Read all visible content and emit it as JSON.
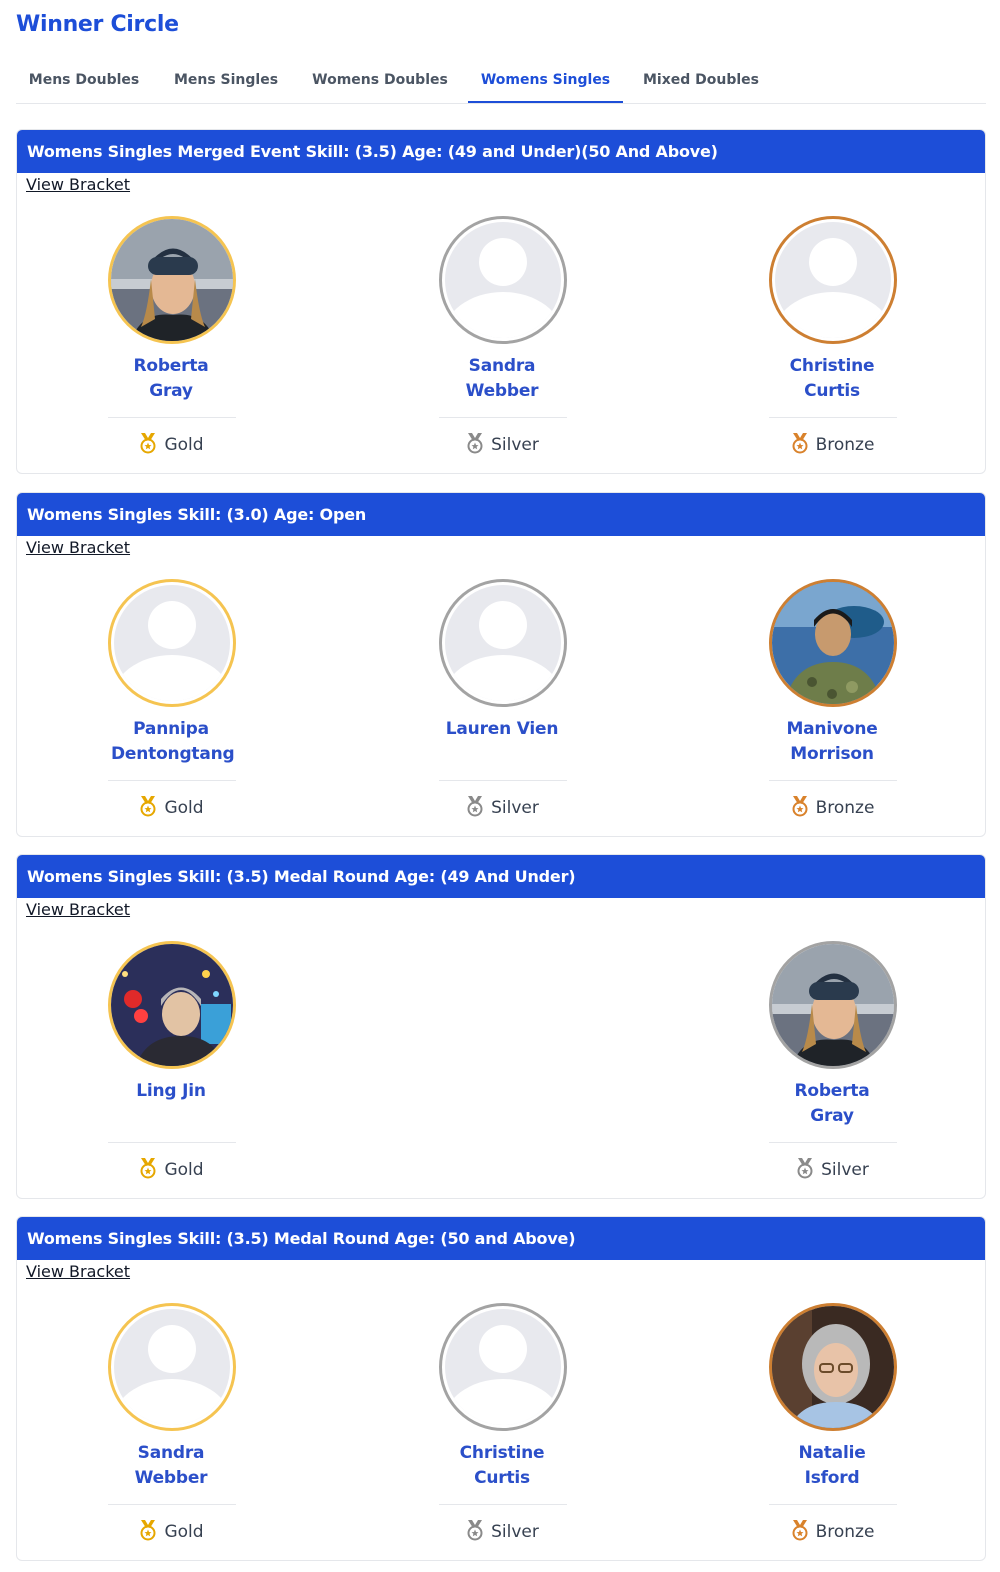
{
  "page": {
    "title": "Winner Circle"
  },
  "tabs": [
    {
      "label": "Mens Doubles"
    },
    {
      "label": "Mens Singles"
    },
    {
      "label": "Womens Doubles"
    },
    {
      "label": "Womens Singles",
      "active": true
    },
    {
      "label": "Mixed Doubles"
    }
  ],
  "colors": {
    "accent": "#1d4ed8",
    "gold": "#f5c451",
    "silver": "#a3a3a3",
    "bronze": "#cd7f32"
  },
  "events": [
    {
      "title": "Womens Singles Merged Event Skill: (3.5) Age: (49 and Under)(50 And Above)",
      "view_bracket": "View Bracket",
      "winners": [
        {
          "name": "Roberta Gray",
          "medal": "Gold",
          "avatar": "photo"
        },
        {
          "name": "Sandra Webber",
          "medal": "Silver",
          "avatar": "placeholder-icon"
        },
        {
          "name": "Christine Curtis",
          "medal": "Bronze",
          "avatar": "placeholder-icon"
        }
      ]
    },
    {
      "title": "Womens Singles Skill: (3.0) Age: Open",
      "view_bracket": "View Bracket",
      "winners": [
        {
          "name": "Pannipa Dentongtang",
          "medal": "Gold",
          "avatar": "placeholder-icon"
        },
        {
          "name": "Lauren Vien",
          "medal": "Silver",
          "avatar": "placeholder-icon"
        },
        {
          "name": "Manivone Morrison",
          "medal": "Bronze",
          "avatar": "photo"
        }
      ]
    },
    {
      "title": "Womens Singles Skill: (3.5) Medal Round Age: (49 And Under)",
      "view_bracket": "View Bracket",
      "winners": [
        {
          "name": "Ling Jin",
          "medal": "Gold",
          "avatar": "photo"
        },
        {
          "name": "Roberta Gray",
          "medal": "Silver",
          "avatar": "photo"
        }
      ]
    },
    {
      "title": "Womens Singles Skill: (3.5) Medal Round Age: (50 and Above)",
      "view_bracket": "View Bracket",
      "winners": [
        {
          "name": "Sandra Webber",
          "medal": "Gold",
          "avatar": "placeholder-icon"
        },
        {
          "name": "Christine Curtis",
          "medal": "Silver",
          "avatar": "placeholder-icon"
        },
        {
          "name": "Natalie Isford",
          "medal": "Bronze",
          "avatar": "photo"
        }
      ]
    }
  ]
}
